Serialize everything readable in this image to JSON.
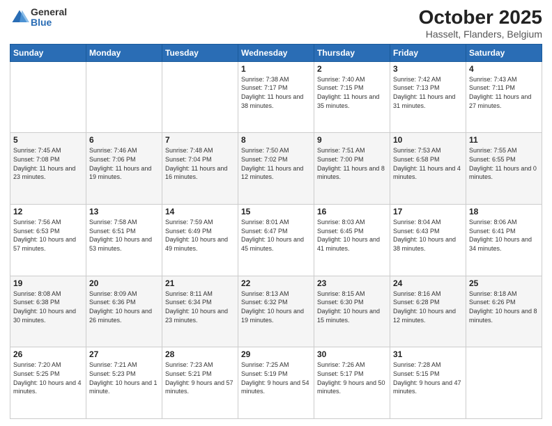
{
  "header": {
    "logo_general": "General",
    "logo_blue": "Blue",
    "title": "October 2025",
    "location": "Hasselt, Flanders, Belgium"
  },
  "weekdays": [
    "Sunday",
    "Monday",
    "Tuesday",
    "Wednesday",
    "Thursday",
    "Friday",
    "Saturday"
  ],
  "weeks": [
    [
      {
        "day": "",
        "sunrise": "",
        "sunset": "",
        "daylight": ""
      },
      {
        "day": "",
        "sunrise": "",
        "sunset": "",
        "daylight": ""
      },
      {
        "day": "",
        "sunrise": "",
        "sunset": "",
        "daylight": ""
      },
      {
        "day": "1",
        "sunrise": "Sunrise: 7:38 AM",
        "sunset": "Sunset: 7:17 PM",
        "daylight": "Daylight: 11 hours and 38 minutes."
      },
      {
        "day": "2",
        "sunrise": "Sunrise: 7:40 AM",
        "sunset": "Sunset: 7:15 PM",
        "daylight": "Daylight: 11 hours and 35 minutes."
      },
      {
        "day": "3",
        "sunrise": "Sunrise: 7:42 AM",
        "sunset": "Sunset: 7:13 PM",
        "daylight": "Daylight: 11 hours and 31 minutes."
      },
      {
        "day": "4",
        "sunrise": "Sunrise: 7:43 AM",
        "sunset": "Sunset: 7:11 PM",
        "daylight": "Daylight: 11 hours and 27 minutes."
      }
    ],
    [
      {
        "day": "5",
        "sunrise": "Sunrise: 7:45 AM",
        "sunset": "Sunset: 7:08 PM",
        "daylight": "Daylight: 11 hours and 23 minutes."
      },
      {
        "day": "6",
        "sunrise": "Sunrise: 7:46 AM",
        "sunset": "Sunset: 7:06 PM",
        "daylight": "Daylight: 11 hours and 19 minutes."
      },
      {
        "day": "7",
        "sunrise": "Sunrise: 7:48 AM",
        "sunset": "Sunset: 7:04 PM",
        "daylight": "Daylight: 11 hours and 16 minutes."
      },
      {
        "day": "8",
        "sunrise": "Sunrise: 7:50 AM",
        "sunset": "Sunset: 7:02 PM",
        "daylight": "Daylight: 11 hours and 12 minutes."
      },
      {
        "day": "9",
        "sunrise": "Sunrise: 7:51 AM",
        "sunset": "Sunset: 7:00 PM",
        "daylight": "Daylight: 11 hours and 8 minutes."
      },
      {
        "day": "10",
        "sunrise": "Sunrise: 7:53 AM",
        "sunset": "Sunset: 6:58 PM",
        "daylight": "Daylight: 11 hours and 4 minutes."
      },
      {
        "day": "11",
        "sunrise": "Sunrise: 7:55 AM",
        "sunset": "Sunset: 6:55 PM",
        "daylight": "Daylight: 11 hours and 0 minutes."
      }
    ],
    [
      {
        "day": "12",
        "sunrise": "Sunrise: 7:56 AM",
        "sunset": "Sunset: 6:53 PM",
        "daylight": "Daylight: 10 hours and 57 minutes."
      },
      {
        "day": "13",
        "sunrise": "Sunrise: 7:58 AM",
        "sunset": "Sunset: 6:51 PM",
        "daylight": "Daylight: 10 hours and 53 minutes."
      },
      {
        "day": "14",
        "sunrise": "Sunrise: 7:59 AM",
        "sunset": "Sunset: 6:49 PM",
        "daylight": "Daylight: 10 hours and 49 minutes."
      },
      {
        "day": "15",
        "sunrise": "Sunrise: 8:01 AM",
        "sunset": "Sunset: 6:47 PM",
        "daylight": "Daylight: 10 hours and 45 minutes."
      },
      {
        "day": "16",
        "sunrise": "Sunrise: 8:03 AM",
        "sunset": "Sunset: 6:45 PM",
        "daylight": "Daylight: 10 hours and 41 minutes."
      },
      {
        "day": "17",
        "sunrise": "Sunrise: 8:04 AM",
        "sunset": "Sunset: 6:43 PM",
        "daylight": "Daylight: 10 hours and 38 minutes."
      },
      {
        "day": "18",
        "sunrise": "Sunrise: 8:06 AM",
        "sunset": "Sunset: 6:41 PM",
        "daylight": "Daylight: 10 hours and 34 minutes."
      }
    ],
    [
      {
        "day": "19",
        "sunrise": "Sunrise: 8:08 AM",
        "sunset": "Sunset: 6:38 PM",
        "daylight": "Daylight: 10 hours and 30 minutes."
      },
      {
        "day": "20",
        "sunrise": "Sunrise: 8:09 AM",
        "sunset": "Sunset: 6:36 PM",
        "daylight": "Daylight: 10 hours and 26 minutes."
      },
      {
        "day": "21",
        "sunrise": "Sunrise: 8:11 AM",
        "sunset": "Sunset: 6:34 PM",
        "daylight": "Daylight: 10 hours and 23 minutes."
      },
      {
        "day": "22",
        "sunrise": "Sunrise: 8:13 AM",
        "sunset": "Sunset: 6:32 PM",
        "daylight": "Daylight: 10 hours and 19 minutes."
      },
      {
        "day": "23",
        "sunrise": "Sunrise: 8:15 AM",
        "sunset": "Sunset: 6:30 PM",
        "daylight": "Daylight: 10 hours and 15 minutes."
      },
      {
        "day": "24",
        "sunrise": "Sunrise: 8:16 AM",
        "sunset": "Sunset: 6:28 PM",
        "daylight": "Daylight: 10 hours and 12 minutes."
      },
      {
        "day": "25",
        "sunrise": "Sunrise: 8:18 AM",
        "sunset": "Sunset: 6:26 PM",
        "daylight": "Daylight: 10 hours and 8 minutes."
      }
    ],
    [
      {
        "day": "26",
        "sunrise": "Sunrise: 7:20 AM",
        "sunset": "Sunset: 5:25 PM",
        "daylight": "Daylight: 10 hours and 4 minutes."
      },
      {
        "day": "27",
        "sunrise": "Sunrise: 7:21 AM",
        "sunset": "Sunset: 5:23 PM",
        "daylight": "Daylight: 10 hours and 1 minute."
      },
      {
        "day": "28",
        "sunrise": "Sunrise: 7:23 AM",
        "sunset": "Sunset: 5:21 PM",
        "daylight": "Daylight: 9 hours and 57 minutes."
      },
      {
        "day": "29",
        "sunrise": "Sunrise: 7:25 AM",
        "sunset": "Sunset: 5:19 PM",
        "daylight": "Daylight: 9 hours and 54 minutes."
      },
      {
        "day": "30",
        "sunrise": "Sunrise: 7:26 AM",
        "sunset": "Sunset: 5:17 PM",
        "daylight": "Daylight: 9 hours and 50 minutes."
      },
      {
        "day": "31",
        "sunrise": "Sunrise: 7:28 AM",
        "sunset": "Sunset: 5:15 PM",
        "daylight": "Daylight: 9 hours and 47 minutes."
      },
      {
        "day": "",
        "sunrise": "",
        "sunset": "",
        "daylight": ""
      }
    ]
  ]
}
